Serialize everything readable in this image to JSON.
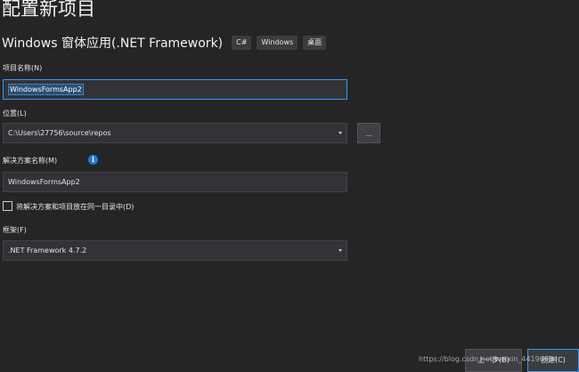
{
  "page": {
    "title": "配置新项目"
  },
  "template": {
    "name": "Windows 窗体应用(.NET Framework)",
    "tags": [
      "C#",
      "Windows",
      "桌面"
    ]
  },
  "project_name": {
    "label": "项目名称(N)",
    "value": "WindowsFormsApp2"
  },
  "location": {
    "label": "位置(L)",
    "value": "C:\\Users\\27756\\source\\repos",
    "browse_label": "..."
  },
  "solution_name": {
    "label": "解决方案名称(M)",
    "info_icon": "i",
    "value": "WindowsFormsApp2"
  },
  "same_directory": {
    "label": "将解决方案和项目放在同一目录中(D)",
    "checked": false
  },
  "framework": {
    "label": "框架(F)",
    "value": ".NET Framework 4.7.2"
  },
  "footer": {
    "back_label": "上一步(B)",
    "create_label": "创建(C)"
  },
  "watermark": "https://blog.csdn.net/weixin_44190954",
  "colors": {
    "background": "#252526",
    "field": "#333337",
    "focus": "#3399ff",
    "selection": "#264f78",
    "info": "#1e7bd4"
  }
}
